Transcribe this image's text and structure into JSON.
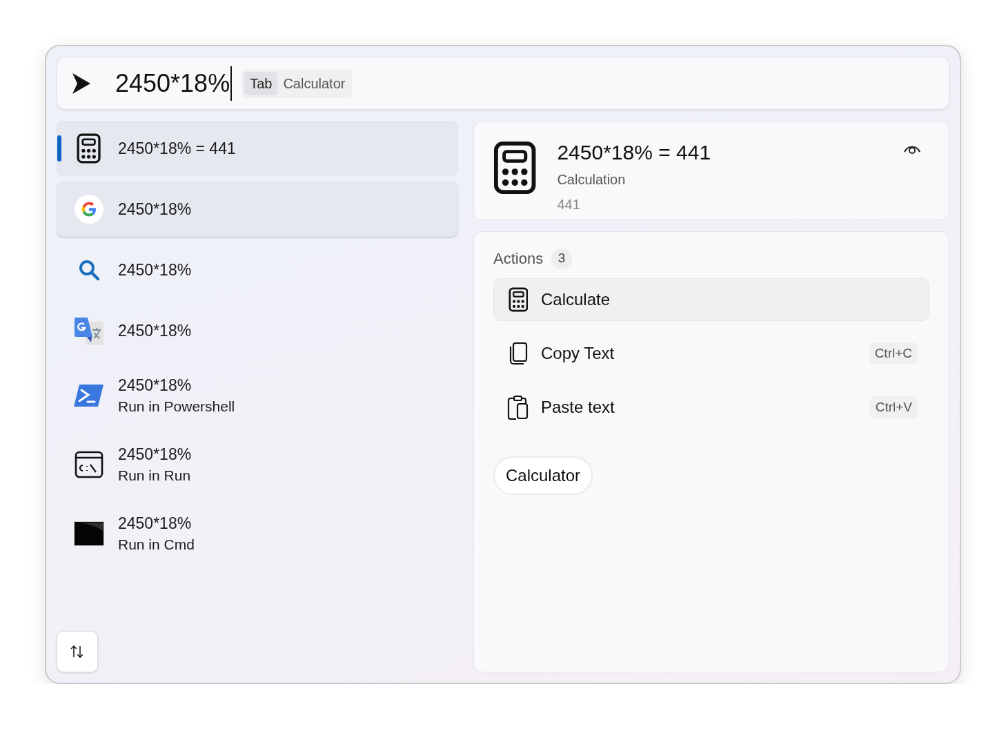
{
  "query": {
    "value": "2450*18%",
    "hint_key": "Tab",
    "hint_text": "Calculator"
  },
  "results": [
    {
      "kind": "calculator",
      "title": "2450*18% = 441",
      "selected": true,
      "hovered": false
    },
    {
      "kind": "google",
      "title": "2450*18%",
      "selected": false,
      "hovered": true
    },
    {
      "kind": "search",
      "title": "2450*18%",
      "selected": false,
      "hovered": false
    },
    {
      "kind": "translate",
      "title": "2450*18%",
      "selected": false,
      "hovered": false
    },
    {
      "kind": "powershell",
      "title": "2450*18%",
      "subtitle": "Run in Powershell",
      "selected": false,
      "hovered": false
    },
    {
      "kind": "run",
      "title": "2450*18%",
      "subtitle": "Run in Run",
      "selected": false,
      "hovered": false
    },
    {
      "kind": "cmd",
      "title": "2450*18%",
      "subtitle": "Run in Cmd",
      "selected": false,
      "hovered": false
    }
  ],
  "detail": {
    "title": "2450*18% = 441",
    "subtitle": "Calculation",
    "value": "441"
  },
  "actions": {
    "title": "Actions",
    "count": "3",
    "items": [
      {
        "kind": "calculator",
        "label": "Calculate",
        "selected": true
      },
      {
        "kind": "copy",
        "label": "Copy Text",
        "shortcut": "Ctrl+C",
        "selected": false
      },
      {
        "kind": "paste",
        "label": "Paste text",
        "shortcut": "Ctrl+V",
        "selected": false
      }
    ],
    "plugin": "Calculator"
  }
}
